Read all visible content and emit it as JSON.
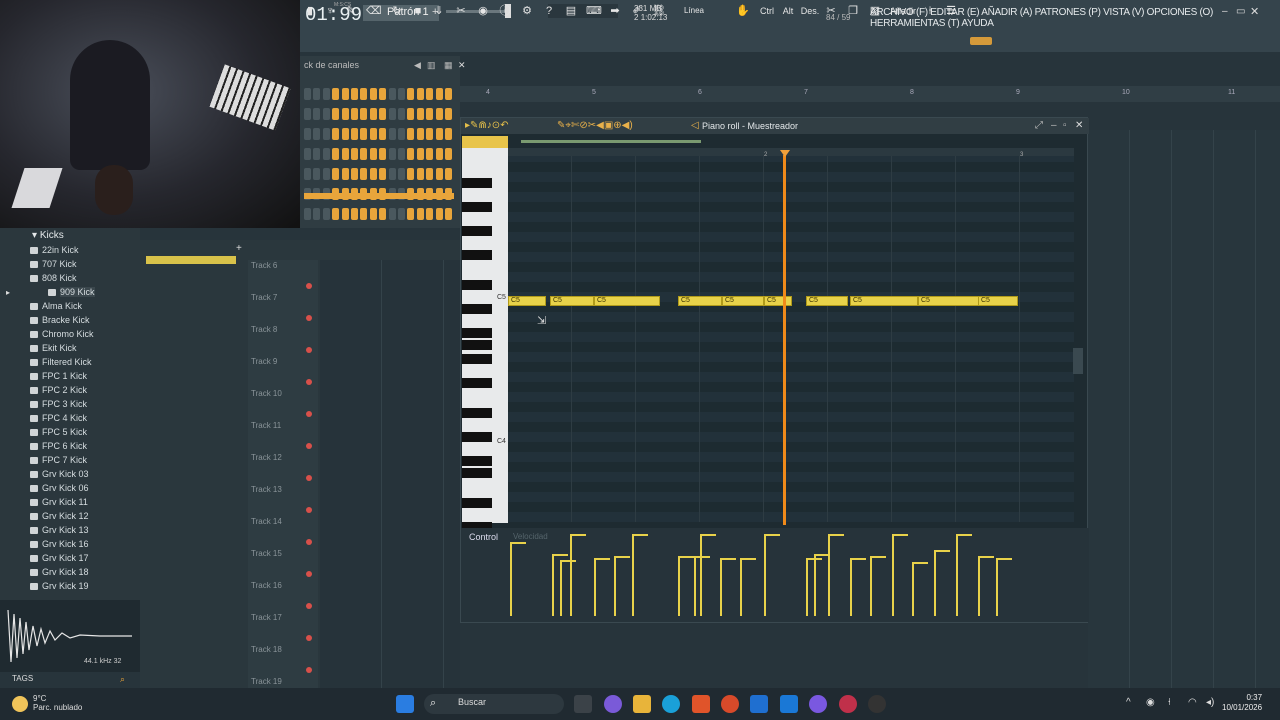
{
  "topbar": {
    "time": "01:99",
    "time_small": "M:S:CS",
    "pattern": "Patrón 1",
    "memory": "331 MB",
    "memory2": "2",
    "meter": "1:02:13",
    "size_info": "84 / 59",
    "menu": "ARCHIVO (F) EDITAR (E) AÑADIR (A) PATRONES (P) VISTA (V) OPCIONES (O) HERRAMIENTAS (T) AYUDA"
  },
  "toolbar": {
    "line_label": "Línea",
    "ctrl": "Ctrl",
    "alt": "Alt",
    "des": "Des.",
    "add": "Añadir"
  },
  "channel_rack": {
    "title": "ck de canales"
  },
  "browser": {
    "folder": "Kicks",
    "items": [
      "22in Kick",
      "707 Kick",
      "808 Kick",
      "909 Kick",
      "Alma Kick",
      "Bracke Kick",
      "Chromo Kick",
      "Ekit Kick",
      "Filtered Kick",
      "FPC 1 Kick",
      "FPC 2 Kick",
      "FPC 3 Kick",
      "FPC 4 Kick",
      "FPC 5 Kick",
      "FPC 6 Kick",
      "FPC 7 Kick",
      "Grv Kick 03",
      "Grv Kick 06",
      "Grv Kick 11",
      "Grv Kick 12",
      "Grv Kick 13",
      "Grv Kick 16",
      "Grv Kick 17",
      "Grv Kick 18",
      "Grv Kick 19"
    ],
    "sample_info": "44.1 kHz 32",
    "tags": "TAGS"
  },
  "playlist": {
    "tracks": [
      "Track 6",
      "Track 7",
      "Track 8",
      "Track 9",
      "Track 10",
      "Track 11",
      "Track 12",
      "Track 13",
      "Track 14",
      "Track 15",
      "Track 16",
      "Track 17",
      "Track 18",
      "Track 19"
    ]
  },
  "ruler": {
    "marks": [
      "4",
      "5",
      "6",
      "7",
      "8",
      "9",
      "10",
      "11"
    ]
  },
  "piano_roll": {
    "title": "Piano roll - Muestreador",
    "bar2": "2",
    "bar3": "3",
    "key_c5": "C5",
    "key_c4": "C4",
    "note_label": "C5",
    "control_label": "Control",
    "control_sub": "Velocidad"
  },
  "taskbar": {
    "weather_temp": "9°C",
    "weather_desc": "Parc. nublado",
    "search": "Buscar",
    "time": "0:37",
    "date": "10/01/2026"
  }
}
